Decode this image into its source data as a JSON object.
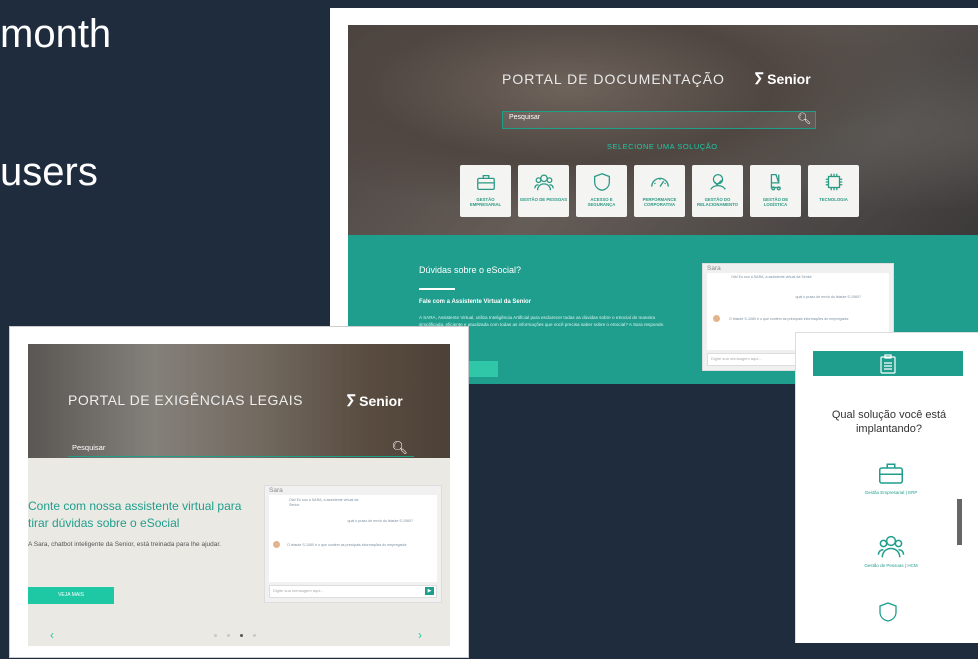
{
  "slide": {
    "line1": "month",
    "line2": "users"
  },
  "doc_portal": {
    "title": "PORTAL DE DOCUMENTAÇÃO",
    "logo_text": "Senior",
    "search_placeholder": "Pesquisar",
    "select_label": "SELECIONE UMA SOLUÇÃO",
    "tiles": [
      {
        "icon": "briefcase-icon",
        "label": "GESTÃO EMPRESARIAL"
      },
      {
        "icon": "people-icon",
        "label": "GESTÃO DE PESSOAS"
      },
      {
        "icon": "shield-icon",
        "label": "ACESSO E SEGURANÇA"
      },
      {
        "icon": "gauge-icon",
        "label": "PERFORMANCE CORPORATIVA"
      },
      {
        "icon": "handshake-icon",
        "label": "GESTÃO DO RELACIONAMENTO"
      },
      {
        "icon": "forklift-icon",
        "label": "GESTÃO DE LOGÍSTICA"
      },
      {
        "icon": "circuit-icon",
        "label": "TECNOLOGIA"
      }
    ],
    "band_question": "Dúvidas sobre o eSocial?",
    "band_subtitle": "Fale com a Assistente Virtual da Senior",
    "band_desc": "A SARA, Assistente Virtual, utiliza Inteligência Artificial para esclarecer todas as dúvidas sobre o eSocial de maneira simplificada, eficiente e atualizada com todas as informações que você precisa saber sobre o eSocial? A Sara responde.",
    "chat_name": "Sara",
    "chat_input_placeholder": "Digite sua mensagem aqui...",
    "chat_msg1": "Olá! Eu sou a SARA, a assistente virtual da Senior",
    "chat_msg2": "qual o prazo de envio do leiaute S-1060?",
    "chat_msg3": "O leiaute S-1060 é o que contém as principais informações do empregador"
  },
  "legal_portal": {
    "title": "PORTAL DE EXIGÊNCIAS LEGAIS",
    "logo_text": "Senior",
    "search_placeholder": "Pesquisar",
    "headline": "Conte com nossa assistente virtual para tirar dúvidas sobre o eSocial",
    "desc": "A Sara, chatbot inteligente da Senior, está treinada para lhe ajudar.",
    "cta": "VEJA MAIS",
    "prev": "‹",
    "next": "›",
    "chat_name": "Sara",
    "chat_input_placeholder": "Digite sua mensagem aqui...",
    "chat_msg1": "Olá! Eu sou a SARA, a assistente virtual da Senior",
    "chat_msg2": "qual o prazo de envio do leiaute S-1060?",
    "chat_msg3": "O leiaute S-1060 é o que contém as principais informações do empregador"
  },
  "mobile": {
    "question": "Qual solução você está implantando?",
    "items": [
      {
        "icon": "briefcase-icon",
        "label": "Gestão Empresarial | ERP"
      },
      {
        "icon": "people-icon",
        "label": "Gestão de Pessoas | HCM"
      }
    ]
  }
}
